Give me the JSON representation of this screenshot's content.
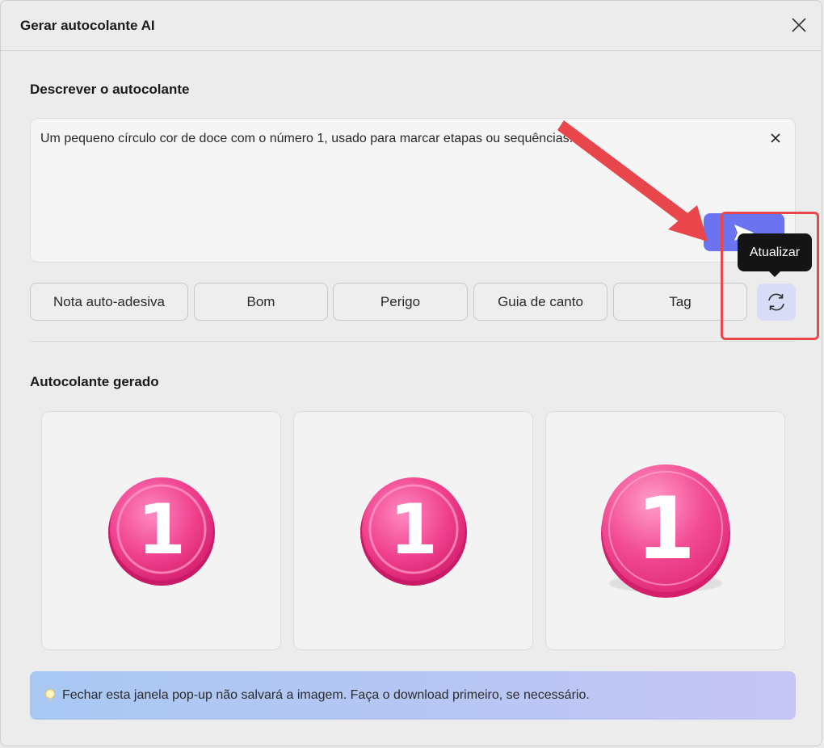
{
  "window": {
    "title": "Gerar autocolante AI"
  },
  "describe": {
    "label": "Descrever o autocolante",
    "prompt_value": "Um pequeno círculo cor de doce com o número 1, usado para marcar etapas ou sequências."
  },
  "chips": [
    "Nota auto-adesiva",
    "Bom",
    "Perigo",
    "Guia de canto",
    "Tag"
  ],
  "refresh": {
    "tooltip": "Atualizar"
  },
  "generated": {
    "label": "Autocolante gerado",
    "stickers": [
      {
        "number": "1",
        "icon": "pink-number-one-sticker"
      },
      {
        "number": "1",
        "icon": "pink-number-one-sticker"
      },
      {
        "number": "1",
        "icon": "pink-number-one-sticker"
      }
    ]
  },
  "notice": {
    "icon": "lightbulb-icon",
    "text": "Fechar esta janela pop-up não salvará a imagem. Faça o download primeiro, se necessário."
  },
  "colors": {
    "accent": "#6b73f0",
    "sticker_pink": "#f0418e",
    "annotation_red": "#e8464a"
  }
}
